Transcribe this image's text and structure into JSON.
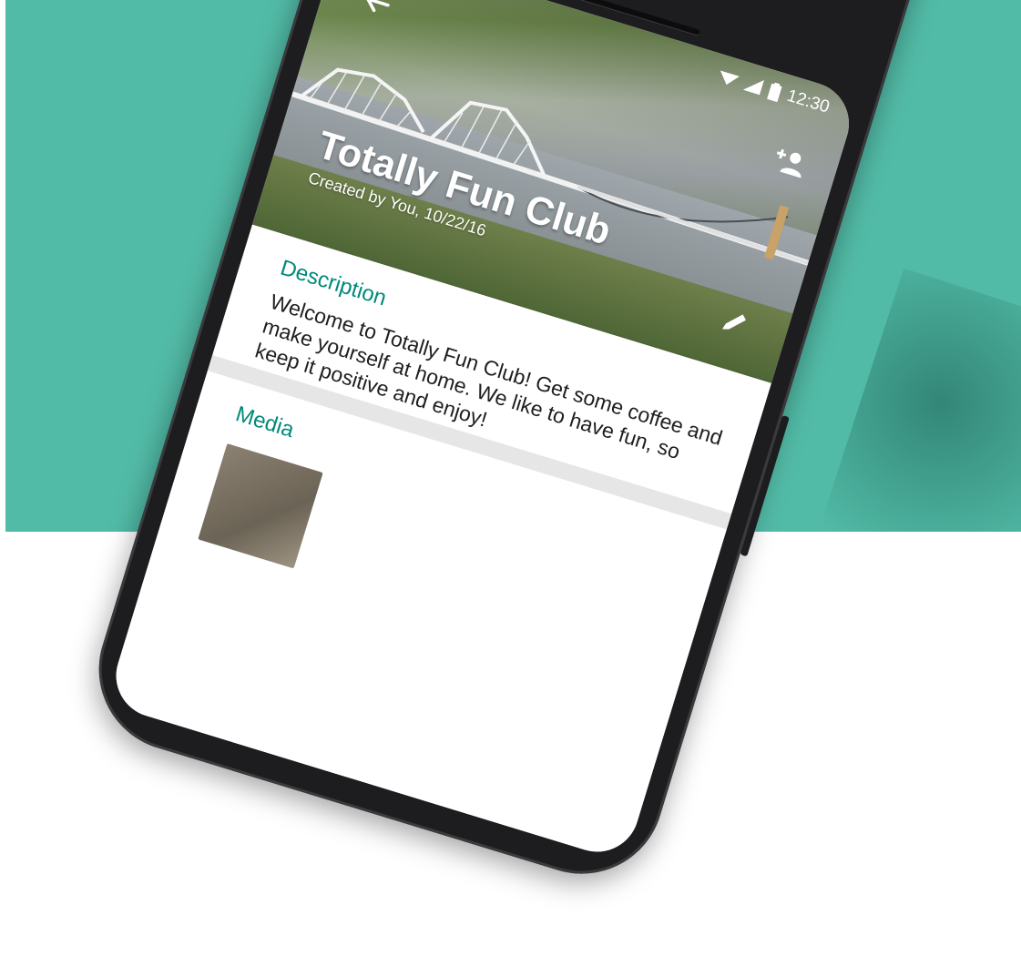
{
  "status_bar": {
    "time": "12:30",
    "icons": [
      "wifi-icon",
      "signal-icon",
      "battery-icon"
    ]
  },
  "header": {
    "back_icon": "arrow-back-icon",
    "add_participant_icon": "person-add-icon",
    "edit_icon": "pencil-icon"
  },
  "group": {
    "name": "Totally Fun Club",
    "created": "Created by You, 10/22/16"
  },
  "description": {
    "title": "Description",
    "text": "Welcome to Totally Fun Club! Get some coffee and make yourself at home. We like to have fun, so keep it positive and enjoy!"
  },
  "media": {
    "title": "Media"
  },
  "colors": {
    "background": "#52bba7",
    "accent": "#00897b",
    "phone_body": "#1d1d1f"
  }
}
